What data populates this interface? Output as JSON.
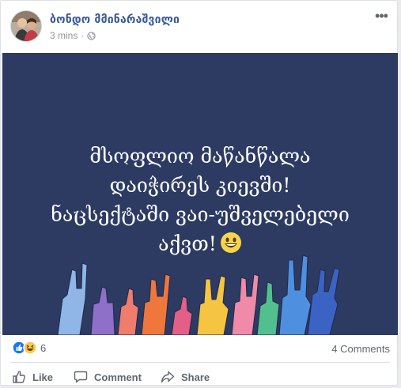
{
  "post": {
    "author": "ბონდო მმინარაშვილი",
    "time": "3 mins",
    "separator": "·",
    "more_label": "•••",
    "privacy_icon": "globe-icon",
    "banner": {
      "background": "#2d3b63",
      "lines": [
        "მსოფლიო მაწანწალა",
        "დაიჭირეს კიევში!",
        "ნაცსექტაში ვაი-უშველებელი",
        "აქვთ!"
      ],
      "emoji": "grinning-face-icon"
    },
    "reactions": {
      "icons": [
        "like-icon",
        "haha-icon"
      ],
      "count": "6"
    },
    "comments_count": "4 Comments",
    "actions": {
      "like": "Like",
      "comment": "Comment",
      "share": "Share"
    }
  }
}
